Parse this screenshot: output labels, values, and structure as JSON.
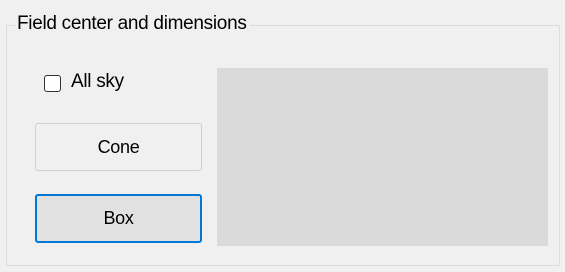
{
  "groupbox": {
    "title": "Field center and dimensions"
  },
  "all_sky": {
    "label": "All sky",
    "checked": false
  },
  "buttons": {
    "cone_label": "Cone",
    "box_label": "Box"
  },
  "colors": {
    "background": "#f0f0f0",
    "focus_border": "#0078d7",
    "preview_fill": "#dadada"
  }
}
